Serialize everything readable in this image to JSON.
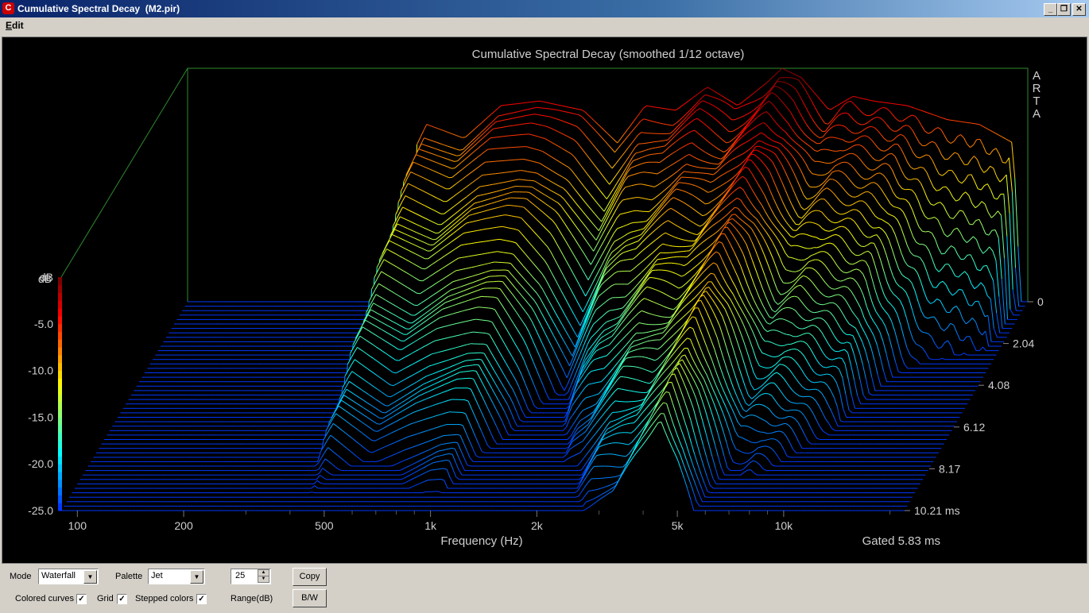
{
  "window": {
    "title": "Cumulative Spectral Decay  (M2.pir)",
    "app_icon": "C",
    "controls": {
      "minimize": "_",
      "restore": "❐",
      "close": "✕"
    }
  },
  "menu": {
    "edit": "Edit"
  },
  "chart_data": {
    "type": "waterfall",
    "title": "Cumulative Spectral Decay (smoothed 1/12 octave)",
    "xlabel": "Frequency (Hz)",
    "x_ticks": [
      {
        "value": 100,
        "label": "100"
      },
      {
        "value": 200,
        "label": "200"
      },
      {
        "value": 500,
        "label": "500"
      },
      {
        "value": 1000,
        "label": "1k"
      },
      {
        "value": 2000,
        "label": "2k"
      },
      {
        "value": 5000,
        "label": "5k"
      },
      {
        "value": 10000,
        "label": "10k"
      }
    ],
    "x_scale": "log",
    "xlim": [
      90,
      22000
    ],
    "zlabel": "dB",
    "z_ticks": [
      "dB",
      "-5.0",
      "-10.0",
      "-15.0",
      "-20.0",
      "-25.0"
    ],
    "zlim": [
      -25,
      0
    ],
    "t_ticks": [
      "0",
      "2.04",
      "4.08",
      "6.12",
      "8.17",
      "10.21 ms"
    ],
    "tlim": [
      0,
      10.21
    ],
    "watermark": "ARTA",
    "gated_label": "Gated 5.83 ms",
    "palette": "Jet",
    "num_slices": 48,
    "response_at_t0": [
      {
        "f": 390,
        "db": -25
      },
      {
        "f": 400,
        "db": -8.5
      },
      {
        "f": 430,
        "db": -6.0
      },
      {
        "f": 550,
        "db": -7.5
      },
      {
        "f": 700,
        "db": -4.0
      },
      {
        "f": 900,
        "db": -3.5
      },
      {
        "f": 1200,
        "db": -4.5
      },
      {
        "f": 1500,
        "db": -8.0
      },
      {
        "f": 1800,
        "db": -4.0
      },
      {
        "f": 2200,
        "db": -4.5
      },
      {
        "f": 2700,
        "db": -2.0
      },
      {
        "f": 3300,
        "db": -4.0
      },
      {
        "f": 4000,
        "db": -1.5
      },
      {
        "f": 4400,
        "db": 0.0
      },
      {
        "f": 5000,
        "db": -1.0
      },
      {
        "f": 6000,
        "db": -4.5
      },
      {
        "f": 7000,
        "db": -3.0
      },
      {
        "f": 8000,
        "db": -3.5
      },
      {
        "f": 10000,
        "db": -4.0
      },
      {
        "f": 13000,
        "db": -5.5
      },
      {
        "f": 16000,
        "db": -6.0
      },
      {
        "f": 20000,
        "db": -8.0
      },
      {
        "f": 21000,
        "db": -25
      }
    ],
    "decay_rates": [
      {
        "f": 400,
        "rate": 0.45
      },
      {
        "f": 700,
        "rate": 0.55
      },
      {
        "f": 1000,
        "rate": 0.5
      },
      {
        "f": 1500,
        "rate": 0.9
      },
      {
        "f": 2000,
        "rate": 0.6
      },
      {
        "f": 3000,
        "rate": 0.45
      },
      {
        "f": 4500,
        "rate": 0.32
      },
      {
        "f": 6000,
        "rate": 0.55
      },
      {
        "f": 8000,
        "rate": 0.6
      },
      {
        "f": 10000,
        "rate": 0.7
      },
      {
        "f": 14000,
        "rate": 1.5
      },
      {
        "f": 20000,
        "rate": 1.6
      }
    ]
  },
  "controls": {
    "mode_label": "Mode",
    "mode_value": "Waterfall",
    "palette_label": "Palette",
    "palette_value": "Jet",
    "range_value": "25",
    "range_label": "Range(dB)",
    "copy_label": "Copy",
    "bw_label": "B/W",
    "colored_curves_label": "Colored curves",
    "colored_curves_checked": "✓",
    "grid_label": "Grid",
    "grid_checked": "✓",
    "stepped_colors_label": "Stepped colors",
    "stepped_colors_checked": "✓"
  }
}
